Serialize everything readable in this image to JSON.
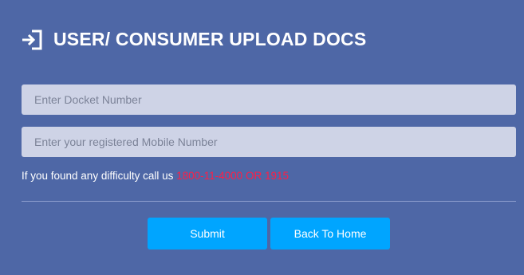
{
  "header": {
    "title": "USER/ CONSUMER UPLOAD DOCS",
    "icon": "sign-in-icon"
  },
  "form": {
    "docket_placeholder": "Enter Docket Number",
    "docket_value": "",
    "mobile_placeholder": "Enter your registered Mobile Number",
    "mobile_value": "",
    "help_text": "If you found any difficulty call us",
    "help_phone": "1800-11-4000 OR 1915"
  },
  "buttons": {
    "submit_label": "Submit",
    "back_label": "Back To Home"
  },
  "colors": {
    "background": "#4e67a6",
    "input_background": "#ced3e6",
    "button": "#00a5ff",
    "phone_text": "#ff1e46"
  }
}
